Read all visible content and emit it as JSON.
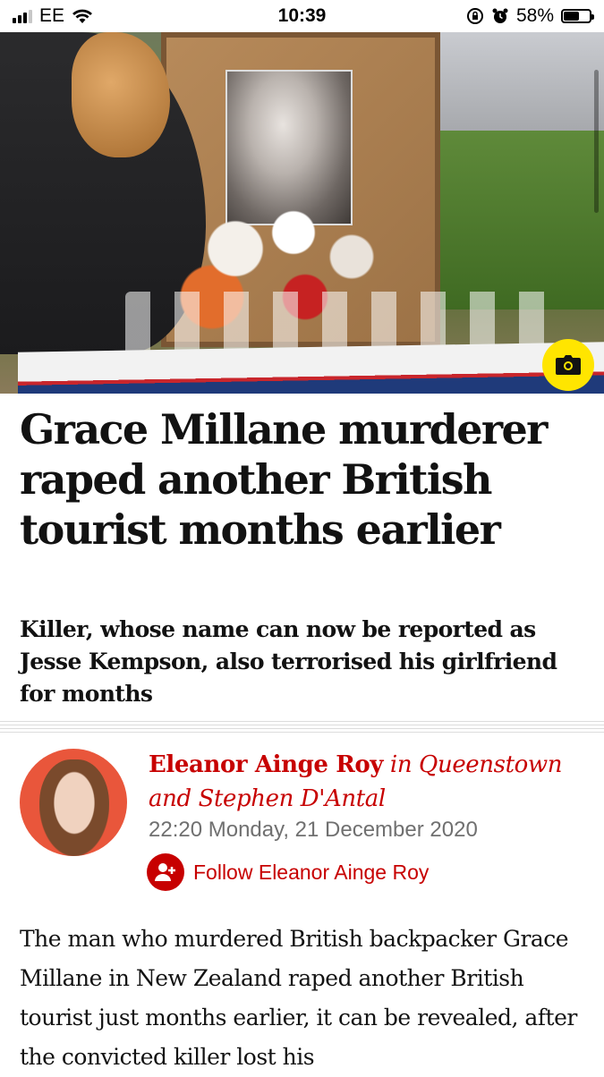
{
  "status_bar": {
    "carrier": "EE",
    "time": "10:39",
    "battery_percent": "58%",
    "battery_level": 0.58
  },
  "hero": {
    "camera_icon": "camera-icon"
  },
  "article": {
    "headline": "Grace Millane murderer raped another British tourist months earlier",
    "standfirst": "Killer, whose name can now be reported as Jesse Kempson, also terrorised his girlfriend for months",
    "byline": {
      "author1": "Eleanor Ainge Roy",
      "location": " in Queenstown and ",
      "author2": "Stephen D'Antal",
      "date": "22:20 Monday, 21 December 2020",
      "follow_label": "Follow Eleanor Ainge Roy"
    },
    "body": "The man who murdered British backpacker Grace Millane in New Zealand raped another British tourist just months earlier, it can be revealed, after the convicted killer lost his"
  },
  "colors": {
    "accent": "#c70000",
    "camera_button": "#ffe500",
    "avatar_bg": "#e9563b"
  }
}
